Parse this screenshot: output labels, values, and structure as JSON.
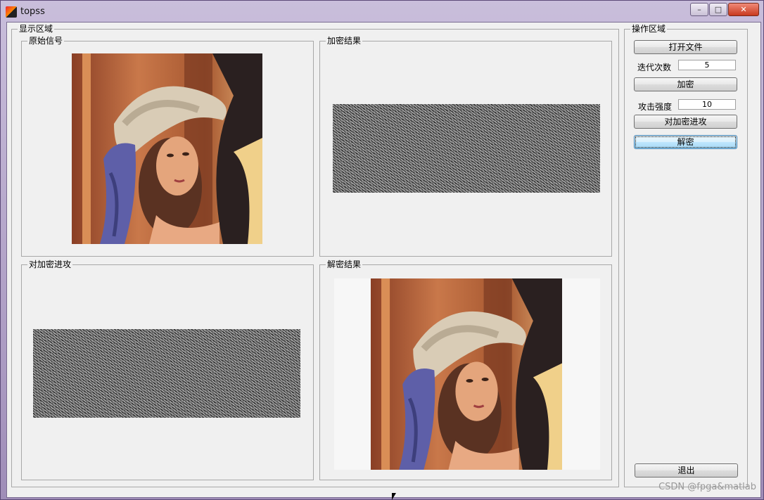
{
  "window": {
    "title": "topss",
    "minimize": "–",
    "maximize": "□",
    "close": "✕"
  },
  "display_area": {
    "legend": "显示区域",
    "panels": {
      "original": "原始信号",
      "encrypted": "加密结果",
      "attack": "对加密进攻",
      "decrypted": "解密结果"
    }
  },
  "ops_area": {
    "legend": "操作区域",
    "open_file": "打开文件",
    "iterations_label": "迭代次数",
    "iterations_value": "5",
    "encrypt": "加密",
    "attack_strength_label": "攻击强度",
    "attack_strength_value": "10",
    "attack": "对加密进攻",
    "decrypt": "解密",
    "exit": "退出"
  },
  "watermark": "CSDN @fpga&matlab",
  "icons": {
    "app": "matlab-icon",
    "portrait": "lena-portrait-image"
  }
}
